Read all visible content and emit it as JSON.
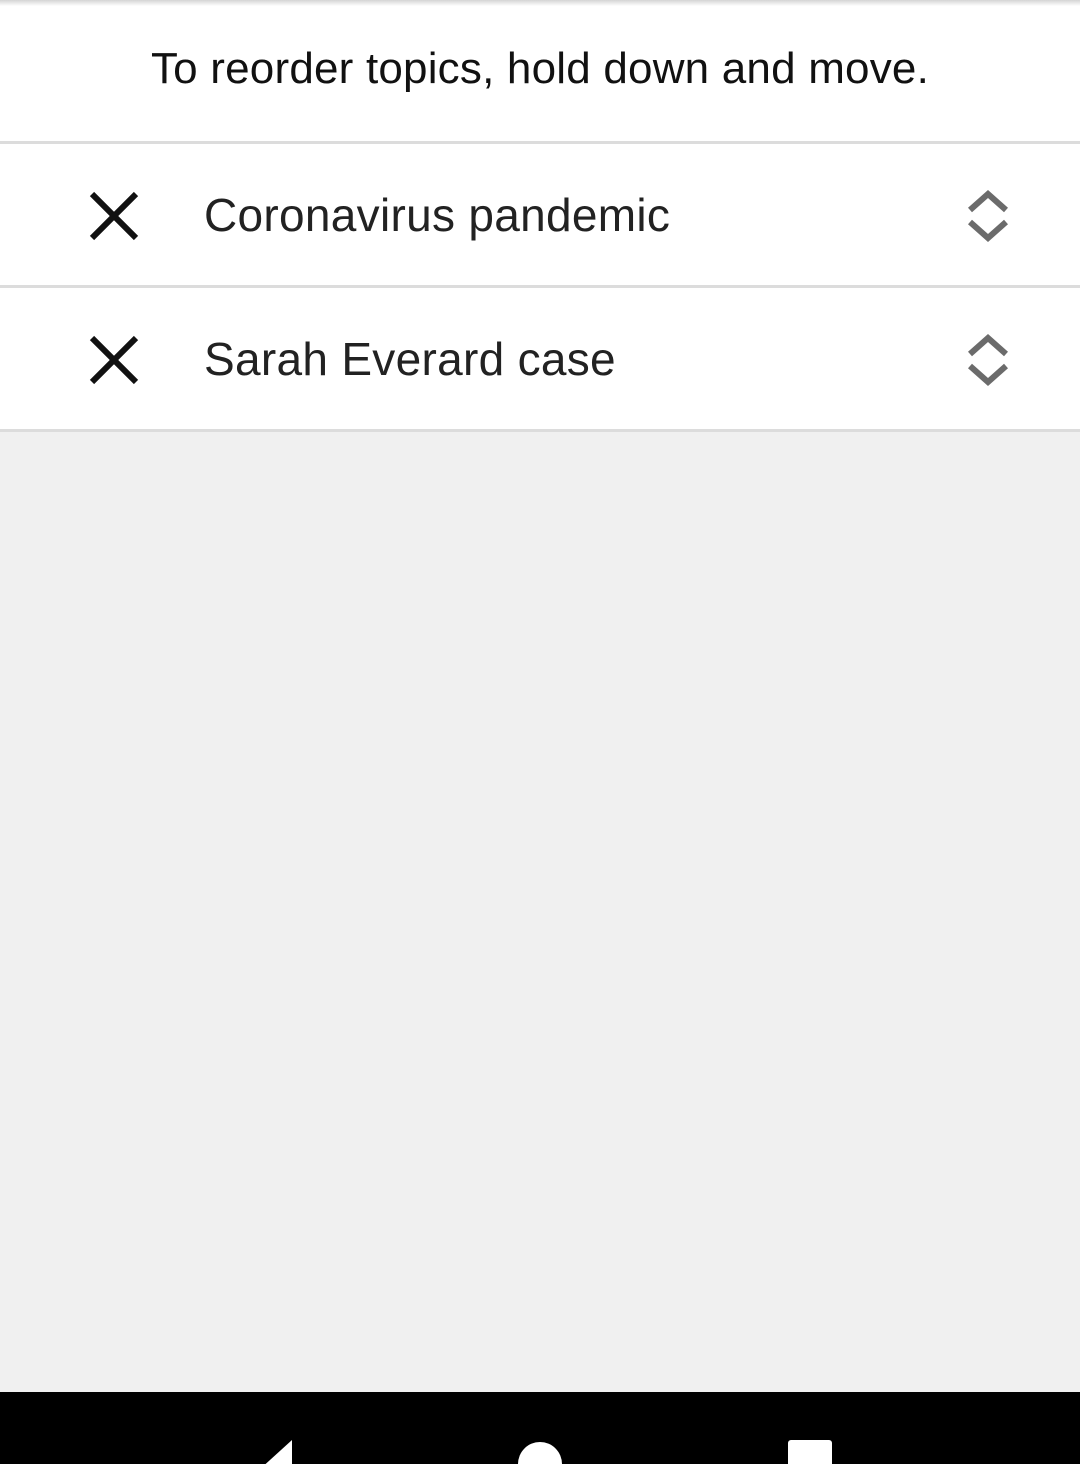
{
  "header": {
    "instruction": "To reorder topics, hold down and move."
  },
  "topics": [
    {
      "label": "Coronavirus pandemic",
      "remove_icon": "close-icon",
      "handle_icon": "reorder-icon"
    },
    {
      "label": "Sarah Everard case",
      "remove_icon": "close-icon",
      "handle_icon": "reorder-icon"
    }
  ],
  "nav_bar": {
    "items": [
      "back-icon",
      "home-icon",
      "recents-icon"
    ]
  },
  "colors": {
    "background": "#f0f0f0",
    "surface": "#ffffff",
    "divider": "#dcdcdc",
    "text": "#222222",
    "handle": "#6b6b6b",
    "nav_bar": "#000000"
  }
}
